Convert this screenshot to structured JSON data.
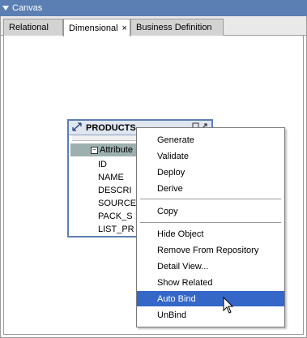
{
  "window": {
    "title": "Canvas"
  },
  "tabs": [
    {
      "label": "Relational",
      "active": false
    },
    {
      "label": "Dimensional",
      "active": true,
      "close": "×"
    },
    {
      "label": "Business Definition",
      "active": false
    }
  ],
  "products": {
    "title": "PRODUCTS",
    "group_label": "Attribute",
    "attributes": [
      "ID",
      "NAME",
      "DESCRI",
      "SOURCE",
      "PACK_S",
      "LIST_PR"
    ]
  },
  "context_menu": {
    "items": [
      {
        "label": "Generate"
      },
      {
        "label": "Validate"
      },
      {
        "label": "Deploy"
      },
      {
        "label": "Derive"
      },
      {
        "label": "Copy"
      },
      {
        "label": "Hide Object"
      },
      {
        "label": "Remove From Repository"
      },
      {
        "label": "Detail View..."
      },
      {
        "label": "Show Related"
      },
      {
        "label": "Auto Bind",
        "selected": true
      },
      {
        "label": "UnBind"
      }
    ]
  },
  "colors": {
    "title_bar": "#5b7fb3",
    "menu_highlight": "#3467c8",
    "attribute_row": "#9db0b0"
  }
}
